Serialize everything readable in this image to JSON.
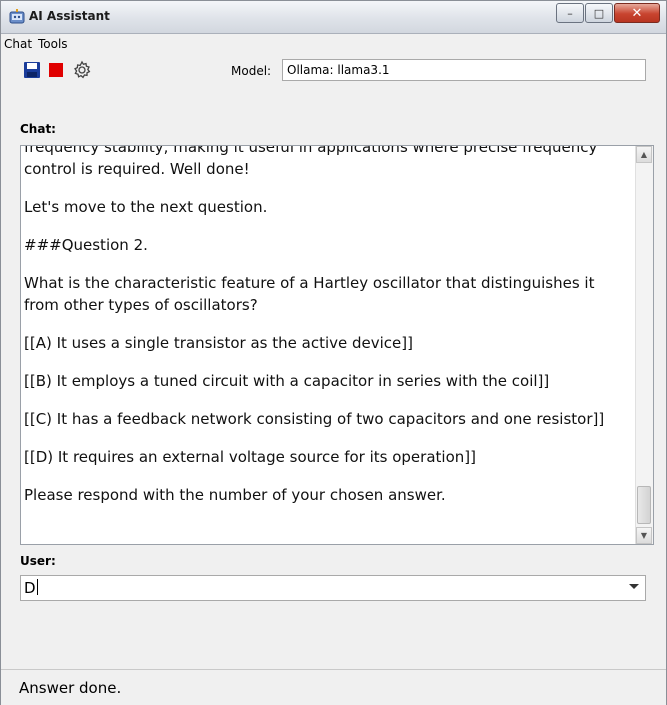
{
  "window": {
    "title": "AI Assistant"
  },
  "menu": {
    "items": [
      "Chat",
      "Tools"
    ]
  },
  "toolbar": {
    "buttons": [
      {
        "icon": "save-icon",
        "color": "#1a3c9a"
      },
      {
        "icon": "stop-icon",
        "color": "#e00000"
      },
      {
        "icon": "gear-icon",
        "color": "#444444"
      }
    ],
    "model_label": "Model:",
    "model_value": "Ollama: llama3.1"
  },
  "chat": {
    "label": "Chat:",
    "messages": [
      "frequency stability, making it useful in applications where precise frequency control is required. Well done!",
      "Let's move to the next question.",
      "###Question 2.",
      "What is the characteristic feature of a Hartley oscillator that distinguishes it from other types of oscillators?",
      "[[A) It uses a single transistor as the active device]]",
      "[[B) It employs a tuned circuit with a capacitor in series with the coil]]",
      "[[C) It has a feedback network consisting of two capacitors and one resistor]]",
      "[[D) It requires an external voltage source for its operation]]",
      "",
      "Please respond with the number of your chosen answer."
    ]
  },
  "user": {
    "label": "User:",
    "value": "D"
  },
  "status": {
    "text": "Answer done."
  }
}
